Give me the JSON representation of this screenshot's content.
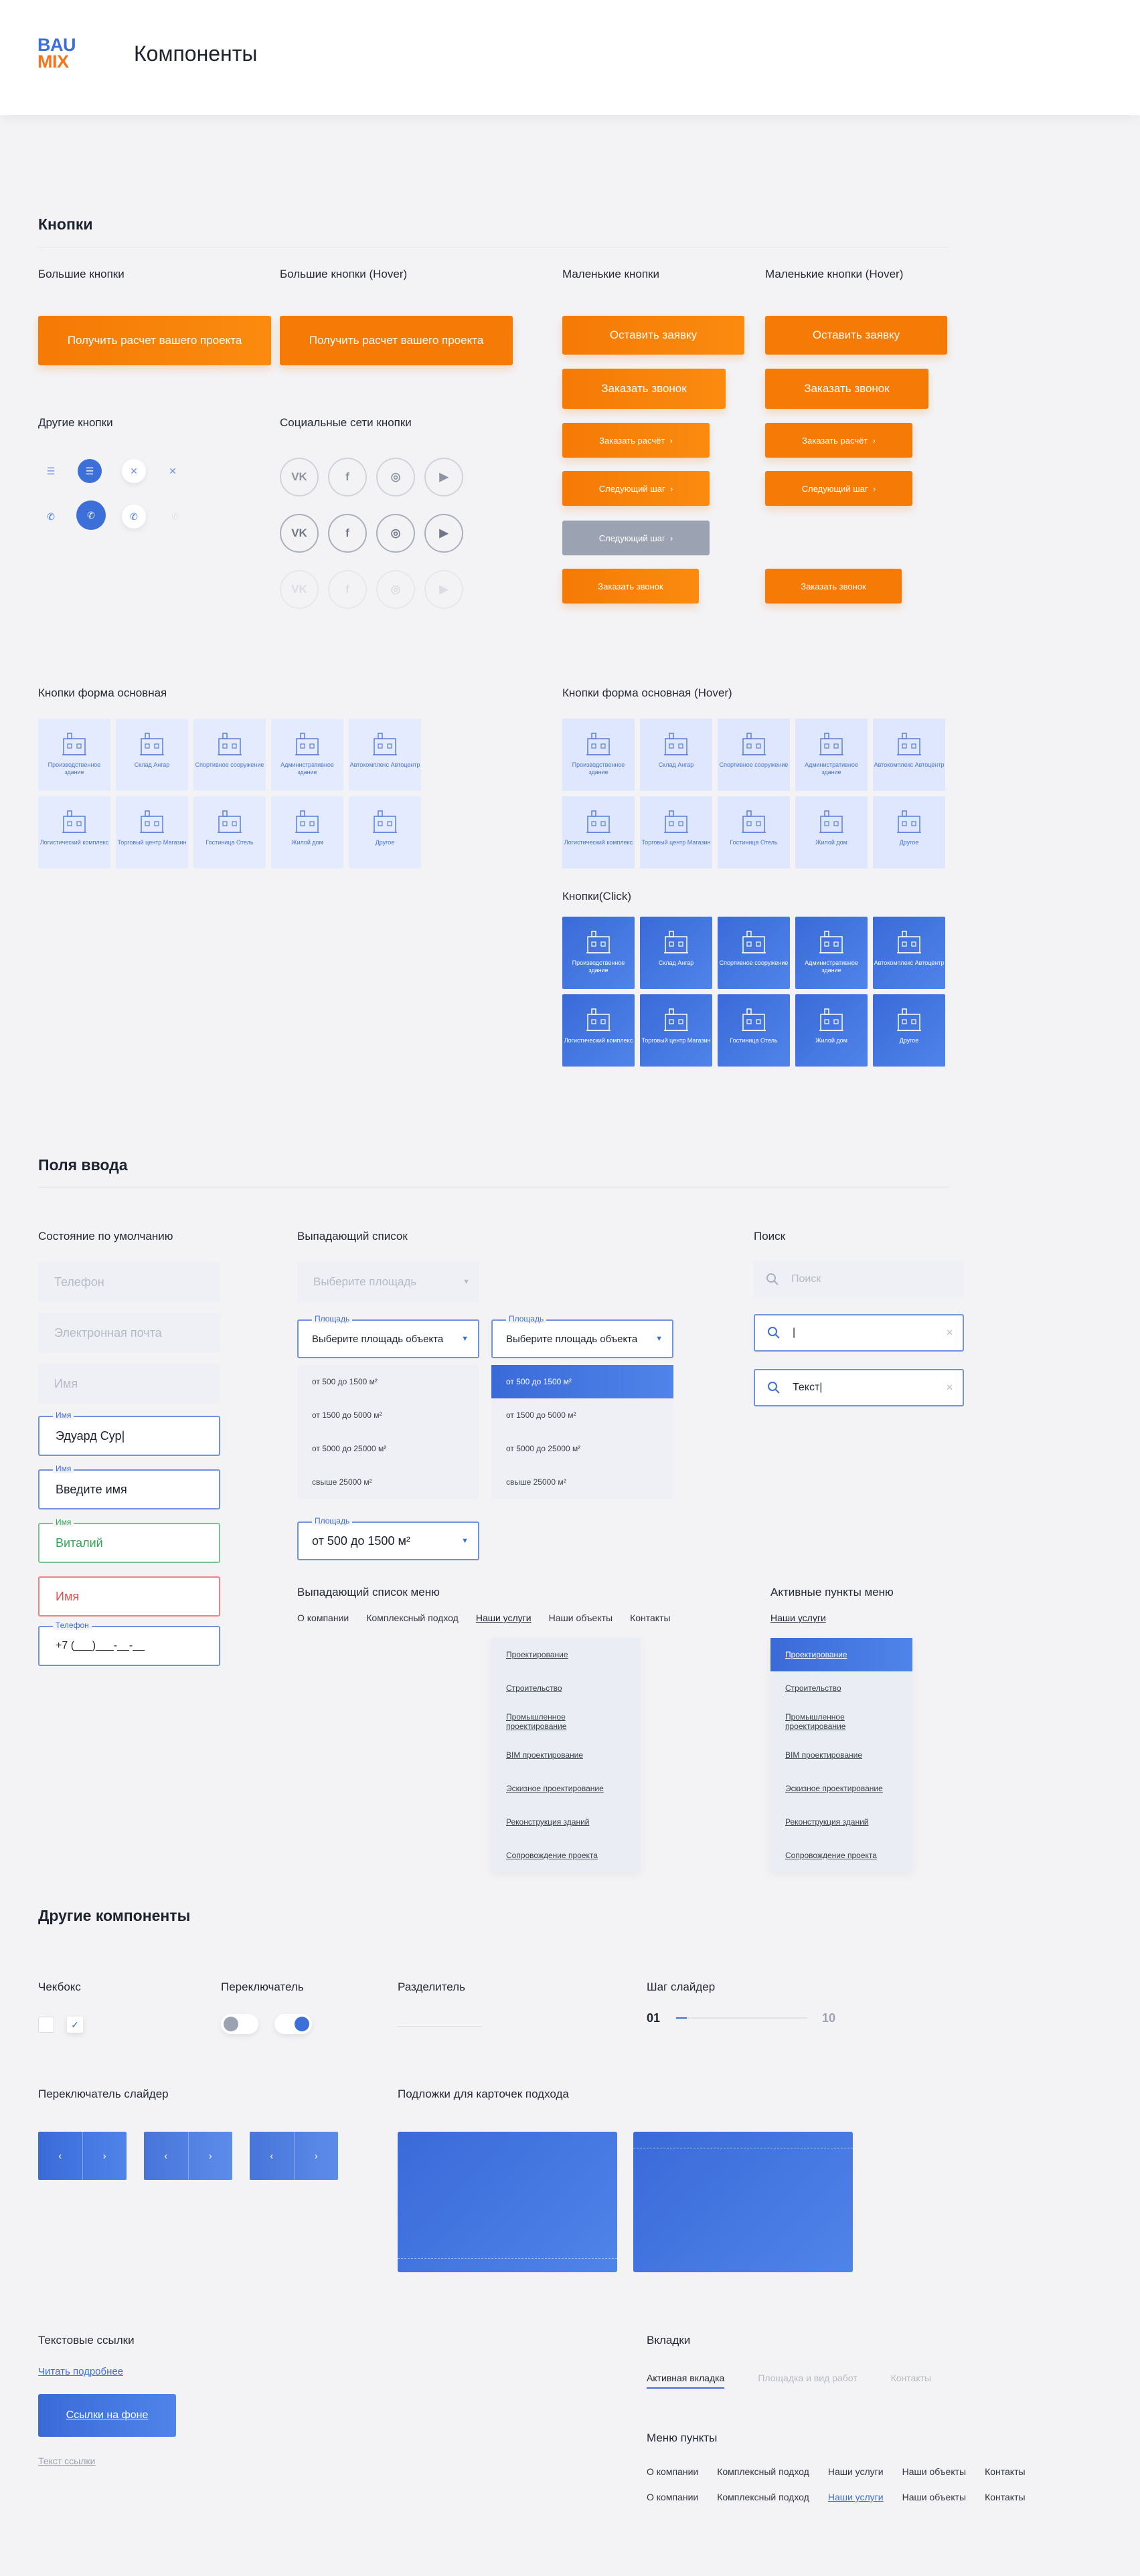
{
  "logo": {
    "line1": "BAU",
    "line2": "MIX"
  },
  "page_title": "Компоненты",
  "buttons": {
    "title": "Кнопки",
    "big_label": "Большие кнопки",
    "big_hover_label": "Большие кнопки (Hover)",
    "small_label": "Маленькие кнопки",
    "small_hover_label": "Маленькие кнопки (Hover)",
    "big_btn": "Получить расчет вашего проекта",
    "small": {
      "leave": "Оставить заявку",
      "call": "Заказать звонок",
      "calc": "Заказать расчёт",
      "next": "Следующий шаг",
      "next_disabled": "Следующий шаг",
      "call2": "Заказать звонок"
    },
    "other_label": "Другие кнопки",
    "social_label": "Социальные сети кнопки",
    "social": {
      "vk": "VK",
      "fb": "f",
      "ig": "◎",
      "yt": "▶"
    },
    "form_label": "Кнопки форма основная",
    "form_hover_label": "Кнопки форма основная (Hover)",
    "form_click_label": "Кнопки(Click)",
    "tiles": [
      "Производственное здание",
      "Склад Ангар",
      "Спортивное сооружение",
      "Административное здание",
      "Автокомплекс Автоцентр",
      "Логистический комплекс",
      "Торговый центр Магазин",
      "Гостиница Отель",
      "Жилой дом",
      "Другое"
    ]
  },
  "inputs": {
    "title": "Поля ввода",
    "default_label": "Состояние по умолчанию",
    "dropdown_label": "Выпадающий список",
    "search_label": "Поиск",
    "ph_phone": "Телефон",
    "ph_email": "Электронная почта",
    "ph_name": "Имя",
    "name_label": "Имя",
    "name_value": "Эдуард Сур",
    "name2_value": "Введите имя",
    "name_ok": "Виталий",
    "name_err": "Имя",
    "phone_label": "Телефон",
    "phone_value": "+7 (___)___-__-__",
    "select_ph": "Выберите площадь",
    "area_label": "Площадь",
    "select_value": "Выберите площадь объекта",
    "options": [
      "от 500 до 1500 м²",
      "от 1500 до 5000 м²",
      "от 5000 до 25000 м²",
      "свыше 25000 м²"
    ],
    "selected_value": "от 500 до 1500 м²",
    "search_ph": "Поиск",
    "search_text": "Текст",
    "menu_dd_label": "Выпадающий список меню",
    "menu_active_label": "Активные пункты меню",
    "menu": [
      "О компании",
      "Комплексный подход",
      "Наши услуги",
      "Наши объекты",
      "Контакты"
    ],
    "services_link": "Наши услуги",
    "submenu": [
      "Проектирование",
      "Строительство",
      "Промышленное проектирование",
      "BIM проектирование",
      "Эскизное проектирование",
      "Реконструкция зданий",
      "Сопровождение проекта"
    ]
  },
  "other": {
    "title": "Другие компоненты",
    "checkbox": "Чекбокс",
    "toggle": "Переключатель",
    "divider": "Разделитель",
    "step": "Шаг слайдер",
    "step_from": "01",
    "step_to": "10",
    "slider_switch": "Переключатель слайдер",
    "cards": "Подложки для карточек подхода",
    "text_links": "Текстовые ссылки",
    "read_more": "Читать подробнее",
    "link_bg": "Ссылки на фоне",
    "link_text": "Текст ссылки",
    "tabs_label": "Вкладки",
    "tabs": [
      "Активная вкладка",
      "Площадка и вид работ",
      "Контакты"
    ],
    "menu_items_label": "Меню пункты",
    "menu": [
      "О компании",
      "Комплексный подход",
      "Наши услуги",
      "Наши объекты",
      "Контакты"
    ]
  },
  "colors": {
    "accent": "#f57a06",
    "brand": "#3c6fd8"
  }
}
